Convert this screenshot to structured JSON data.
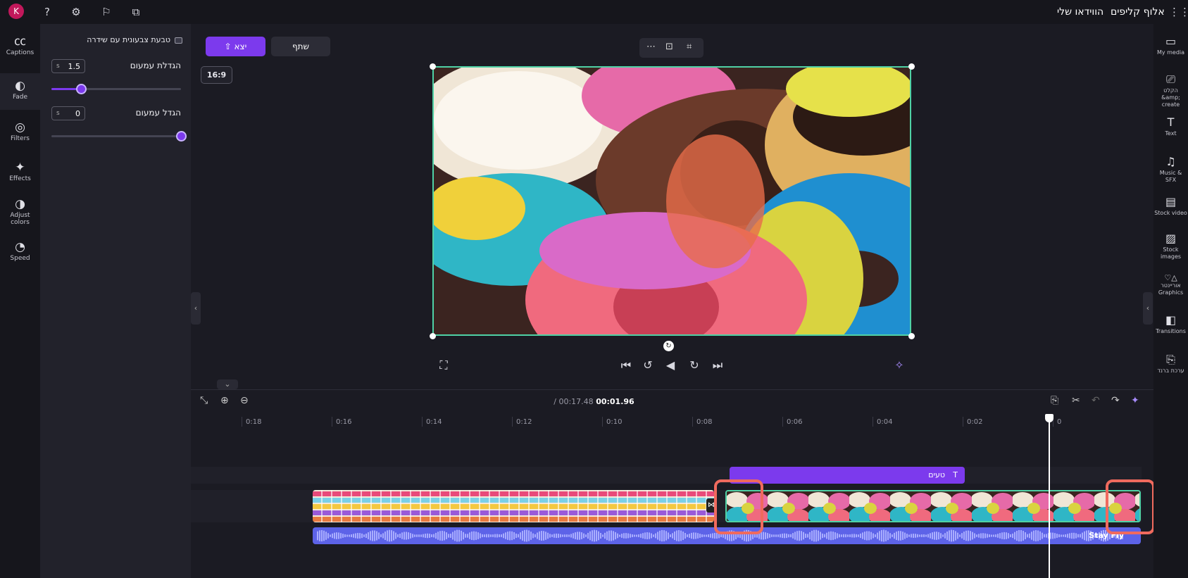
{
  "topbar": {
    "brand": "אלוף קליפים",
    "section": "הווידאו שלי",
    "avatar_initial": "K",
    "help_glyph": "?"
  },
  "left_rail": [
    {
      "label": "Captions",
      "icon": "captions-icon"
    },
    {
      "label": "Fade",
      "icon": "fade-icon"
    },
    {
      "label": "Filters",
      "icon": "filters-icon"
    },
    {
      "label": "Effects",
      "icon": "effects-icon"
    },
    {
      "label": "Adjust colors",
      "icon": "adjust-colors-icon"
    },
    {
      "label": "Speed",
      "icon": "speed-icon"
    }
  ],
  "fade_panel": {
    "header": "טבעת צבעונית עם שידרה",
    "fade_in_label": "הגדלת עמעום",
    "fade_in_value": "1.5",
    "fade_in_unit": "s",
    "fade_in_fraction": 0.23,
    "fade_out_label": "הגדל עמעום",
    "fade_out_value": "0",
    "fade_out_unit": "s",
    "fade_out_fraction": 1.0
  },
  "stage": {
    "export_label": "יצא",
    "share_label": "שתף",
    "aspect_ratio": "16:9"
  },
  "timeline": {
    "current_time": "00:01.96",
    "total_time": "/ 00:17.48",
    "ticks": [
      "0",
      "0:02",
      "0:04",
      "0:06",
      "0:08",
      "0:10",
      "0:12",
      "0:14",
      "0:16",
      "0:18"
    ],
    "text_clip_label": "טעים",
    "audio_clip_label": "Stay Fly"
  },
  "right_rail": [
    {
      "label": "My media",
      "icon": "media-icon"
    },
    {
      "label": "הקלט &amp; create",
      "icon": "record-icon"
    },
    {
      "label": "Text",
      "icon": "text-icon"
    },
    {
      "label": "Music & SFX",
      "icon": "music-icon"
    },
    {
      "label": "Stock video",
      "icon": "stock-video-icon"
    },
    {
      "label": "Stock images",
      "icon": "stock-images-icon"
    },
    {
      "label": "אוריינטר Graphics",
      "icon": "graphics-icon"
    },
    {
      "label": "Transitions",
      "icon": "transitions-icon"
    },
    {
      "label": "ערכת ברנד",
      "icon": "brand-kit-icon"
    }
  ],
  "colors": {
    "accent": "#7c3aed",
    "selection": "#4fd1a5",
    "highlight": "#f06a5e",
    "audio": "#5d63e8"
  }
}
